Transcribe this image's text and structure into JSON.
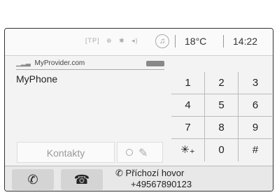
{
  "status": {
    "icons": [
      "TP",
      "sat",
      "bt",
      "vol"
    ],
    "music_icon": "music-icon",
    "temperature": "18°C",
    "time": "14:22"
  },
  "phone": {
    "provider": "MyProvider.com",
    "name": "MyPhone"
  },
  "keypad": {
    "keys": [
      "1",
      "2",
      "3",
      "4",
      "5",
      "6",
      "7",
      "8",
      "9",
      "✳₊",
      "0",
      "#"
    ]
  },
  "buttons": {
    "contacts": "Kontakty"
  },
  "call": {
    "status": "Příchozí hovor",
    "number": "+49567890123"
  }
}
